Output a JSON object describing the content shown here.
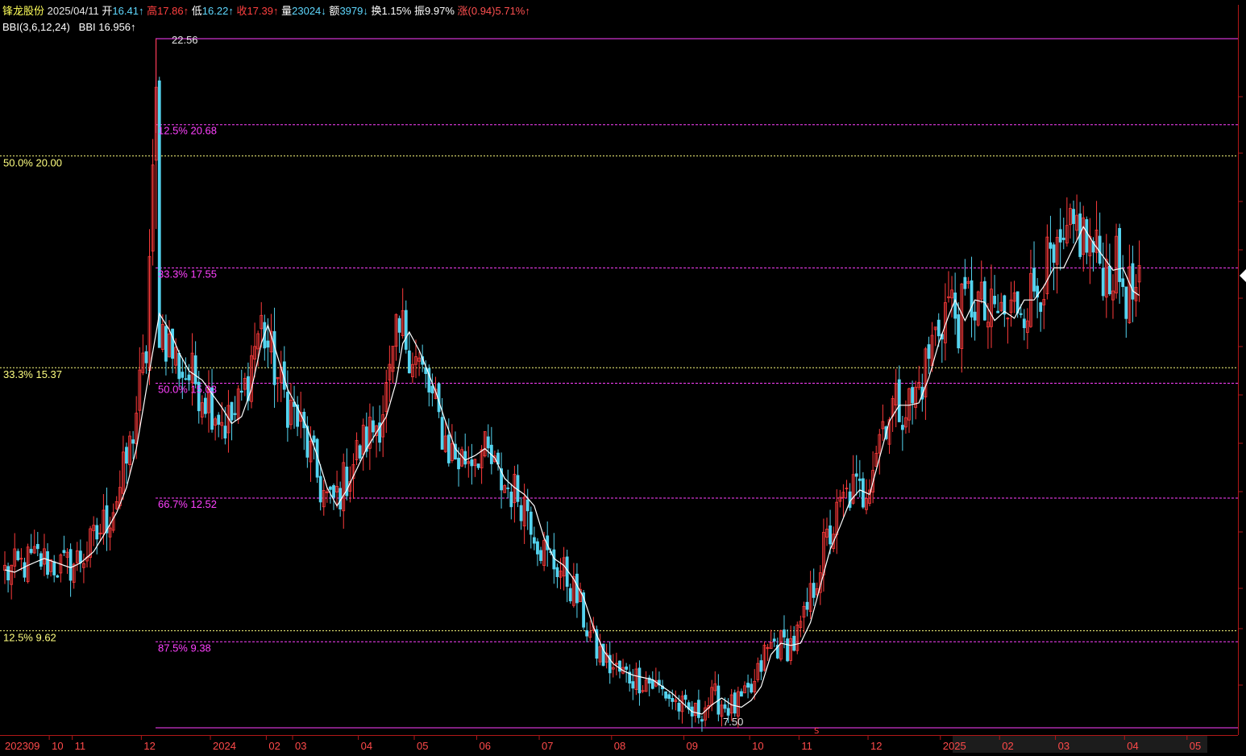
{
  "header": {
    "name": "锋龙股份",
    "date": "2025/04/11",
    "open_label": "开",
    "open": "16.41",
    "high_label": "高",
    "high": "17.86",
    "low_label": "低",
    "low": "16.22",
    "close_label": "收",
    "close": "17.39",
    "vol_label": "量",
    "vol": "23024",
    "amt_label": "额",
    "amt": "3979",
    "turn_label": "换",
    "turn": "1.15%",
    "amp_label": "振",
    "amp": "9.97%",
    "chg_label": "涨",
    "chg": "(0.94)5.71%",
    "up_arrow": "↑",
    "down_arrow": "↓"
  },
  "indicator": {
    "name": "BBI(3,6,12,24)",
    "label": "BBI",
    "value": "16.956",
    "arrow": "↑"
  },
  "colors": {
    "up": "#ff3b3b",
    "down": "#54d4f0",
    "bbi": "#ffffff",
    "fib_a": "#ff40ff",
    "fib_b": "#ffff80",
    "axis": "#b01818",
    "month_label": "#ff4a4a"
  },
  "chart_data": {
    "type": "candlestick",
    "ylim": [
      7.0,
      23.6
    ],
    "price_marks": {
      "high": "22.56",
      "low": "7.50"
    },
    "fib_a": [
      {
        "label": "12.5% 20.68",
        "value": 20.68
      },
      {
        "label": "33.3% 17.55",
        "value": 17.55
      },
      {
        "label": "50.0% 15.03",
        "value": 15.03
      },
      {
        "label": "66.7% 12.52",
        "value": 12.52
      },
      {
        "label": "87.5% 9.38",
        "value": 9.38
      }
    ],
    "fib_b": [
      {
        "label": "50.0% 20.00",
        "value": 20.0
      },
      {
        "label": "33.3% 15.37",
        "value": 15.37
      },
      {
        "label": "12.5% 9.62",
        "value": 9.62
      }
    ],
    "months": [
      {
        "label": "202309",
        "pos": 0
      },
      {
        "label": "10",
        "pos": 14
      },
      {
        "label": "11",
        "pos": 21
      },
      {
        "label": "12",
        "pos": 42
      },
      {
        "label": "2024",
        "pos": 63
      },
      {
        "label": "02",
        "pos": 80
      },
      {
        "label": "03",
        "pos": 88
      },
      {
        "label": "04",
        "pos": 108
      },
      {
        "label": "05",
        "pos": 125
      },
      {
        "label": "06",
        "pos": 144
      },
      {
        "label": "07",
        "pos": 163
      },
      {
        "label": "08",
        "pos": 185
      },
      {
        "label": "09",
        "pos": 207
      },
      {
        "label": "10",
        "pos": 227
      },
      {
        "label": "11",
        "pos": 242
      },
      {
        "label": "12",
        "pos": 263
      },
      {
        "label": "2025",
        "pos": 285
      },
      {
        "label": "02",
        "pos": 303
      },
      {
        "label": "03",
        "pos": 320
      },
      {
        "label": "04",
        "pos": 341
      },
      {
        "label": "05",
        "pos": 360
      }
    ],
    "bbi_knots": [
      [
        0,
        10.95
      ],
      [
        3,
        10.9
      ],
      [
        7,
        11.05
      ],
      [
        12,
        11.2
      ],
      [
        16,
        11.1
      ],
      [
        20,
        11.0
      ],
      [
        23,
        11.1
      ],
      [
        27,
        11.35
      ],
      [
        30,
        11.7
      ],
      [
        34,
        12.2
      ],
      [
        37,
        12.75
      ],
      [
        40,
        13.6
      ],
      [
        44,
        15.3
      ],
      [
        47,
        16.55
      ],
      [
        50,
        16.2
      ],
      [
        53,
        15.7
      ],
      [
        56,
        15.3
      ],
      [
        60,
        15.1
      ],
      [
        63,
        14.8
      ],
      [
        66,
        14.5
      ],
      [
        69,
        14.15
      ],
      [
        72,
        14.3
      ],
      [
        75,
        14.9
      ],
      [
        78,
        15.9
      ],
      [
        80,
        16.3
      ],
      [
        83,
        15.6
      ],
      [
        86,
        14.9
      ],
      [
        89,
        14.5
      ],
      [
        92,
        14.05
      ],
      [
        95,
        13.45
      ],
      [
        98,
        12.75
      ],
      [
        101,
        12.35
      ],
      [
        104,
        12.7
      ],
      [
        107,
        13.15
      ],
      [
        110,
        13.6
      ],
      [
        113,
        13.95
      ],
      [
        116,
        14.3
      ],
      [
        119,
        15.05
      ],
      [
        121,
        15.9
      ],
      [
        123,
        16.15
      ],
      [
        126,
        15.75
      ],
      [
        128,
        15.4
      ],
      [
        131,
        14.85
      ],
      [
        134,
        14.2
      ],
      [
        137,
        13.6
      ],
      [
        140,
        13.35
      ],
      [
        143,
        13.45
      ],
      [
        146,
        13.6
      ],
      [
        149,
        13.4
      ],
      [
        152,
        12.95
      ],
      [
        155,
        12.75
      ],
      [
        158,
        12.6
      ],
      [
        161,
        12.35
      ],
      [
        164,
        11.65
      ],
      [
        167,
        11.2
      ],
      [
        170,
        11.05
      ],
      [
        173,
        10.75
      ],
      [
        176,
        10.35
      ],
      [
        179,
        9.7
      ],
      [
        182,
        9.2
      ],
      [
        185,
        8.9
      ],
      [
        188,
        8.75
      ],
      [
        191,
        8.65
      ],
      [
        194,
        8.6
      ],
      [
        197,
        8.55
      ],
      [
        200,
        8.4
      ],
      [
        203,
        8.25
      ],
      [
        206,
        8.05
      ],
      [
        209,
        7.85
      ],
      [
        212,
        7.8
      ],
      [
        215,
        8.0
      ],
      [
        218,
        8.15
      ],
      [
        221,
        8.0
      ],
      [
        224,
        7.95
      ],
      [
        227,
        8.1
      ],
      [
        230,
        8.4
      ],
      [
        233,
        9.1
      ],
      [
        236,
        9.35
      ],
      [
        239,
        9.3
      ],
      [
        242,
        9.35
      ],
      [
        245,
        9.8
      ],
      [
        248,
        10.6
      ],
      [
        251,
        11.4
      ],
      [
        254,
        11.9
      ],
      [
        257,
        12.45
      ],
      [
        260,
        12.7
      ],
      [
        263,
        12.6
      ],
      [
        266,
        13.4
      ],
      [
        269,
        14.2
      ],
      [
        272,
        14.55
      ],
      [
        275,
        14.55
      ],
      [
        278,
        14.6
      ],
      [
        281,
        15.15
      ],
      [
        284,
        15.9
      ],
      [
        287,
        16.5
      ],
      [
        289,
        16.85
      ],
      [
        292,
        16.4
      ],
      [
        295,
        16.85
      ],
      [
        298,
        16.8
      ],
      [
        301,
        16.4
      ],
      [
        304,
        16.6
      ],
      [
        307,
        16.45
      ],
      [
        310,
        16.85
      ],
      [
        313,
        16.85
      ],
      [
        316,
        17.15
      ],
      [
        319,
        17.55
      ],
      [
        322,
        17.55
      ],
      [
        325,
        18.0
      ],
      [
        328,
        18.45
      ],
      [
        331,
        18.1
      ],
      [
        334,
        17.8
      ],
      [
        337,
        17.5
      ],
      [
        340,
        17.55
      ],
      [
        343,
        17.05
      ],
      [
        345,
        16.95
      ]
    ],
    "candle_notes": "Daily candles 2023-09 to 2025-04-11; yearly high 22.56 (2023-11), low 7.50 (2024-08); last bar O16.41 H17.86 L16.22 C17.39"
  }
}
